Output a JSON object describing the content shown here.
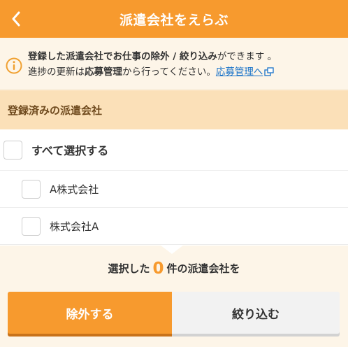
{
  "header": {
    "title": "派遣会社をえらぶ",
    "back_icon": "chevron-left-icon"
  },
  "notice": {
    "info_icon": "info-icon",
    "line1_b1": "登録した派遣会社でお仕事の除外 / 絞り込み",
    "line1_t1": "ができます 。",
    "line2_t1": "進捗の更新は",
    "line2_b1": "応募管理",
    "line2_t2": "から行ってください。",
    "link": "応募管理へ",
    "link_icon": "external-link-icon"
  },
  "section": {
    "title": "登録済みの派遣会社"
  },
  "select_all": {
    "label": "すべて選択する",
    "checked": false
  },
  "companies": [
    {
      "label": "A株式会社",
      "checked": false
    },
    {
      "label": "株式会社A",
      "checked": false
    }
  ],
  "footer": {
    "prefix": "選択した",
    "count": "0",
    "suffix": "件の派遣会社を",
    "exclude_label": "除外する",
    "narrow_label": "絞り込む"
  },
  "colors": {
    "accent": "#f79a2e",
    "section_bg": "#fbe0b8",
    "notice_bg": "#fdf5e8",
    "link": "#1a73c8"
  }
}
